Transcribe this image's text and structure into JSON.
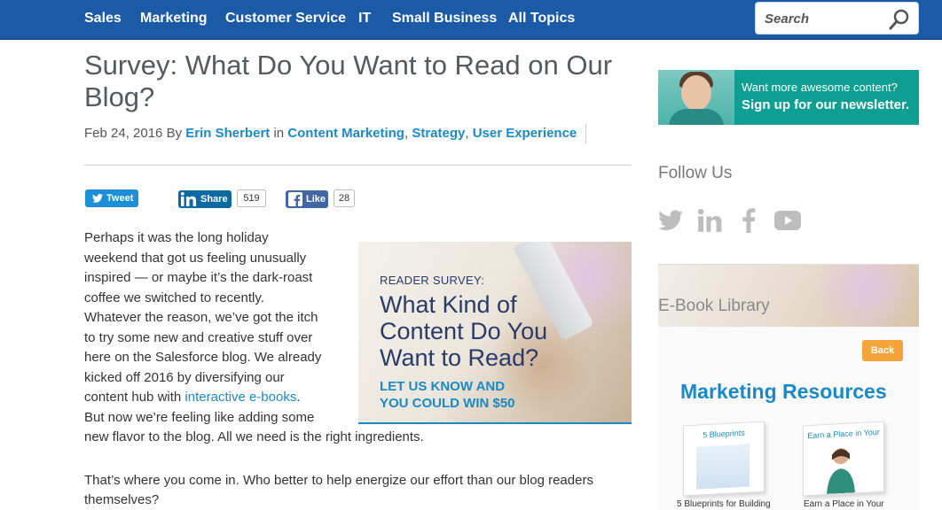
{
  "nav": {
    "items": [
      "Sales",
      "Marketing",
      "Customer Service",
      "IT",
      "Small Business",
      "All Topics"
    ],
    "search_placeholder": "Search"
  },
  "article": {
    "title_line1": "Survey: What Do You Want to Read on Our",
    "title_line2": "Blog?",
    "meta": {
      "date_by": "Feb 24, 2016 By ",
      "author": "Erin Sherbert",
      "in": " in ",
      "cat1": "Content Marketing",
      "sep": ", ",
      "cat2": "Strategy",
      "cat3": "User Experience"
    },
    "share": {
      "tweet": "Tweet",
      "linkedin": "Share",
      "linkedin_count": "519",
      "facebook": "Like",
      "facebook_count": "28"
    },
    "para1": [
      "Perhaps it was the long holiday",
      "weekend that got us feeling unusually",
      "inspired — or maybe it’s the dark-roast",
      "coffee we switched to recently.",
      "Whatever the reason, we’ve got the itch",
      "to try some new and creative stuff over",
      "here on the Salesforce blog. We already",
      "kicked off 2016 by diversifying our"
    ],
    "para1_line9_pre": "content hub with ",
    "para1_line9_link": "interactive e-books",
    "para1_line9_post": ".",
    "para1_line10": "But now we’re feeling like adding some",
    "para1_line11": "new flavor to the blog. All we need is the right ingredients.",
    "para2_line1": "That’s where you come in. Who better to help energize our effort than our blog readers",
    "para2_line2": "themselves?"
  },
  "survey_image": {
    "kicker": "READER SURVEY:",
    "headline": [
      "What Kind of",
      "Content Do You",
      "Want to Read?"
    ],
    "cta": [
      "LET US KNOW AND",
      "YOU COULD WIN $50"
    ]
  },
  "sidebar": {
    "newsletter_line1": "Want more awesome content?",
    "newsletter_line2": "Sign up for our newsletter.",
    "follow_title": "Follow Us",
    "ebook_title": "E-Book Library",
    "back": "Back",
    "resources_title": "Marketing Resources",
    "book1_cover": "5 Blueprints",
    "book1_caption": "5 Blueprints for Building",
    "book2_cover": "Earn a Place in Your",
    "book2_caption": "Earn a Place in Your"
  },
  "colors": {
    "nav_bg": "#1a5aa6",
    "link": "#1a8ac7",
    "newsletter_bg": "#0e9e92",
    "back_btn": "#f3a43a"
  }
}
